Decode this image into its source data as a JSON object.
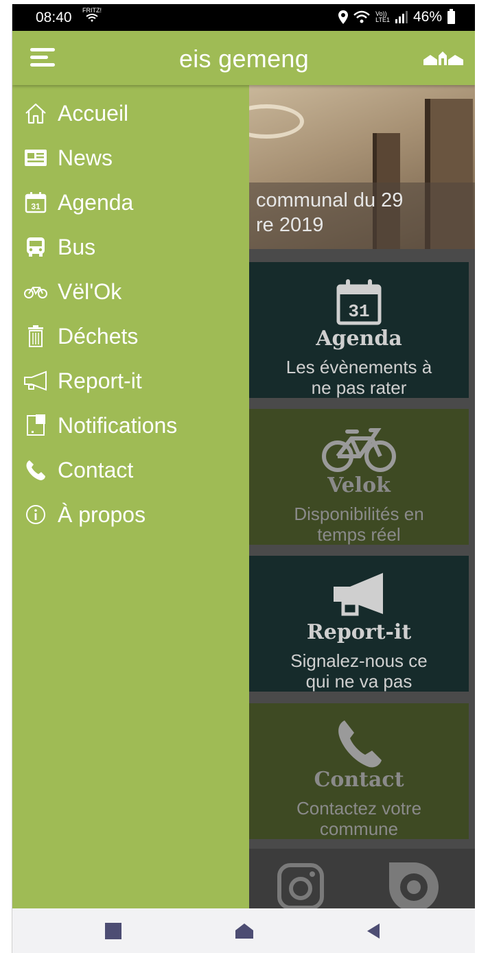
{
  "status_bar": {
    "time": "08:40",
    "network_tag": "FRITZ!",
    "lte_line1": "Vo))",
    "lte_line2": "LTE1",
    "battery": "46%"
  },
  "app_bar": {
    "title": "eis gemeng",
    "menu_icon": "hamburger-icon",
    "logo_icon": "town-logo-icon"
  },
  "drawer": {
    "items": [
      {
        "label": "Accueil",
        "icon": "home-icon"
      },
      {
        "label": "News",
        "icon": "newspaper-icon"
      },
      {
        "label": "Agenda",
        "icon": "calendar-icon"
      },
      {
        "label": "Bus",
        "icon": "bus-icon"
      },
      {
        "label": "Vël'Ok",
        "icon": "bicycle-icon"
      },
      {
        "label": "Déchets",
        "icon": "trash-icon"
      },
      {
        "label": "Report-it",
        "icon": "megaphone-icon"
      },
      {
        "label": "Notifications",
        "icon": "notification-icon"
      },
      {
        "label": "Contact",
        "icon": "phone-icon"
      },
      {
        "label": "À propos",
        "icon": "info-icon"
      }
    ]
  },
  "hero": {
    "caption_line1": "communal du 29",
    "caption_line2": "re 2019"
  },
  "tiles": [
    {
      "name": "Agenda",
      "desc_line1": "Les évènements à",
      "desc_line2": "ne pas rater",
      "calendar_number": "31"
    },
    {
      "name": "Velok",
      "desc_line1": "Disponibilités en",
      "desc_line2": "temps réel"
    },
    {
      "name": "Report-it",
      "desc_line1": "Signalez-nous ce",
      "desc_line2": "qui ne va pas"
    },
    {
      "name": "Contact",
      "desc_line1": "Contactez votre",
      "desc_line2": "commune"
    }
  ],
  "colors": {
    "brand_green": "#9fbb55",
    "tile_dark": "#162b2b",
    "tile_olive": "#3e4a23"
  }
}
